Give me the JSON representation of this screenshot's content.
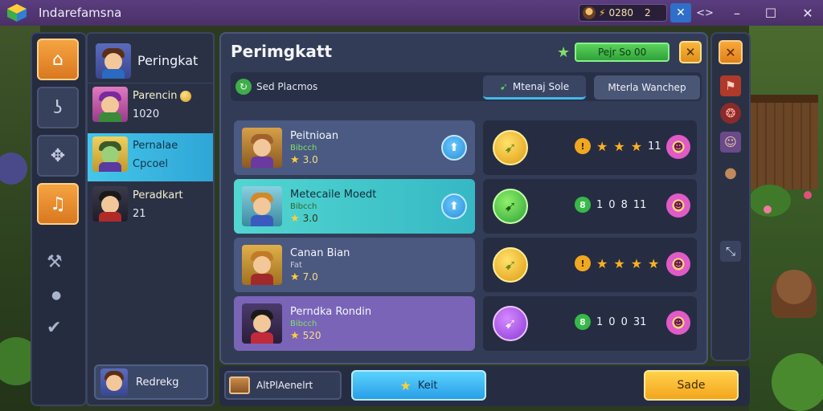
{
  "window": {
    "title": "Indarefamsna",
    "currency_value": "0280",
    "currency_extra": "2"
  },
  "sidebar": {
    "header_name": "Peringkat",
    "items": [
      {
        "line1": "Parencin",
        "line2": "1020"
      },
      {
        "line1": "Pernalae",
        "line2": "Cpcoel"
      },
      {
        "line1": "Peradkart",
        "line2": "21"
      }
    ],
    "footer_label": "Redrekg"
  },
  "main": {
    "title": "Perimgkatt",
    "score_label": "Pejr So 00",
    "filter": {
      "search_label": "Sed Placmos",
      "tab_active": "Mtenaj Sole",
      "tab_other": "Mterla Wanchep"
    },
    "rows": [
      {
        "name": "Peitnioan",
        "tag": "Bibcch",
        "points": "3.0",
        "v1": "11",
        "style": "A"
      },
      {
        "name": "Metecaile Moedt",
        "tag": "Bibcch",
        "points": "3.0",
        "v1": "1",
        "v2": "0",
        "v3": "8",
        "v4": "11",
        "style": "B"
      },
      {
        "name": "Canan Bian",
        "tag": "Fat",
        "points": "7.0",
        "style": "C"
      },
      {
        "name": "Perndka Rondin",
        "tag": "Bibcch",
        "points": "520",
        "v1": "1",
        "v2": "0",
        "v3": "0",
        "v4": "31",
        "style": "D"
      }
    ],
    "reward_counts": {
      "row1_num": "11",
      "row2_nums": [
        "1",
        "0",
        "8",
        "11"
      ],
      "row4_nums": [
        "1",
        "0",
        "0",
        "31"
      ]
    }
  },
  "bottom": {
    "chip_label": "AltPlAenelrt",
    "blue_label": "Keit",
    "save_label": "Sade"
  },
  "colors": {
    "titlebar": "#4a3068",
    "accent_cyan": "#36b8c4",
    "accent_orange": "#f4a41e",
    "accent_green": "#2fa23a"
  },
  "icons": {
    "rail": [
      "home-icon",
      "hook-icon",
      "puzzle-icon",
      "music-icon",
      "hammer-icon",
      "dot-icon",
      "check-icon"
    ],
    "right_rail": [
      "close-icon",
      "flag-icon",
      "shield-icon",
      "portrait-icon",
      "cookie-icon",
      "collapse-icon"
    ]
  }
}
